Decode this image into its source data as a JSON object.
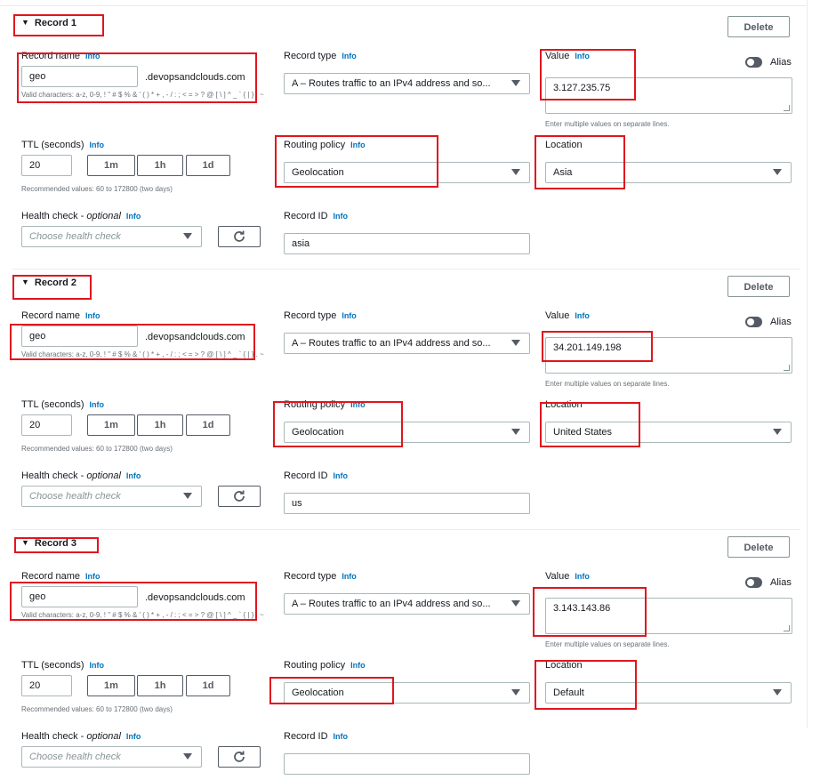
{
  "labels": {
    "record_name": "Record name",
    "record_type": "Record type",
    "value": "Value",
    "ttl": "TTL (seconds)",
    "routing_policy": "Routing policy",
    "location": "Location",
    "health_check": "Health check",
    "optional": "optional",
    "record_id": "Record ID",
    "info": "Info",
    "alias": "Alias",
    "delete": "Delete",
    "domain_suffix": ".devopsandclouds.com",
    "valid_chars": "Valid characters: a-z, 0-9, ! \" # $ % & ' ( ) * + , - / : ; < = > ? @ [ \\ ] ^ _ ` { | } . ~",
    "multi_values_hint": "Enter multiple values on separate lines.",
    "ttl_hint": "Recommended values: 60 to 172800 (two days)",
    "ttl_1m": "1m",
    "ttl_1h": "1h",
    "ttl_1d": "1d",
    "health_check_placeholder": "Choose health check"
  },
  "icons": [
    "caret-down-icon",
    "chevron-down-icon",
    "refresh-icon",
    "toggle-icon"
  ],
  "colors": {
    "link": "#0073bb",
    "annotation_red": "#e0161e",
    "border": "#aab7b8"
  },
  "records": [
    {
      "title": "Record 1",
      "name": "geo",
      "type": "A – Routes traffic to an IPv4 address and so...",
      "value": "3.127.235.75",
      "ttl": "20",
      "routing": "Geolocation",
      "location": "Asia",
      "record_id": "asia"
    },
    {
      "title": "Record 2",
      "name": "geo",
      "type": "A – Routes traffic to an IPv4 address and so...",
      "value": "34.201.149.198",
      "ttl": "20",
      "routing": "Geolocation",
      "location": "United States",
      "record_id": "us"
    },
    {
      "title": "Record 3",
      "name": "geo",
      "type": "A – Routes traffic to an IPv4 address and so...",
      "value": "3.143.143.86",
      "ttl": "20",
      "routing": "Geolocation",
      "location": "Default",
      "record_id": ""
    }
  ]
}
